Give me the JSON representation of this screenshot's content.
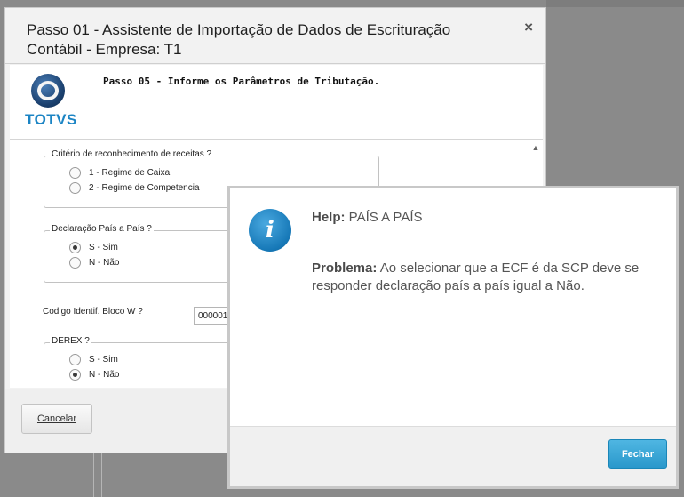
{
  "wizard": {
    "title": "Passo 01 - Assistente de Importação de Dados de Escrituração Contábil - Empresa: T1",
    "close_label": "×",
    "logo_text": "TOTVS",
    "step_title": "Passo 05 - Informe os Parâmetros de Tributação.",
    "cancel_label": "Cancelar"
  },
  "form": {
    "criterio": {
      "legend": "Critério de reconhecimento de receitas ?",
      "options": [
        "1 - Regime de Caixa",
        "2 - Regime de Competencia"
      ],
      "selected": null
    },
    "declaracao": {
      "legend": "Declaração País a País ?",
      "options": [
        "S - Sim",
        "N - Não"
      ],
      "selected": "S - Sim"
    },
    "codigo": {
      "label": "Codigo Identif. Bloco W ?",
      "value": "000001"
    },
    "derex": {
      "legend": "DEREX ?",
      "options": [
        "S - Sim",
        "N - Não"
      ],
      "selected": "N - Não"
    }
  },
  "help": {
    "title_label": "Help:",
    "title_value": "PAÍS A PAÍS",
    "problem_label": "Problema:",
    "problem_text": "Ao selecionar que a ECF é da SCP deve se responder declaração país a país igual a Não.",
    "close_label": "Fechar",
    "icon": "info-icon"
  }
}
